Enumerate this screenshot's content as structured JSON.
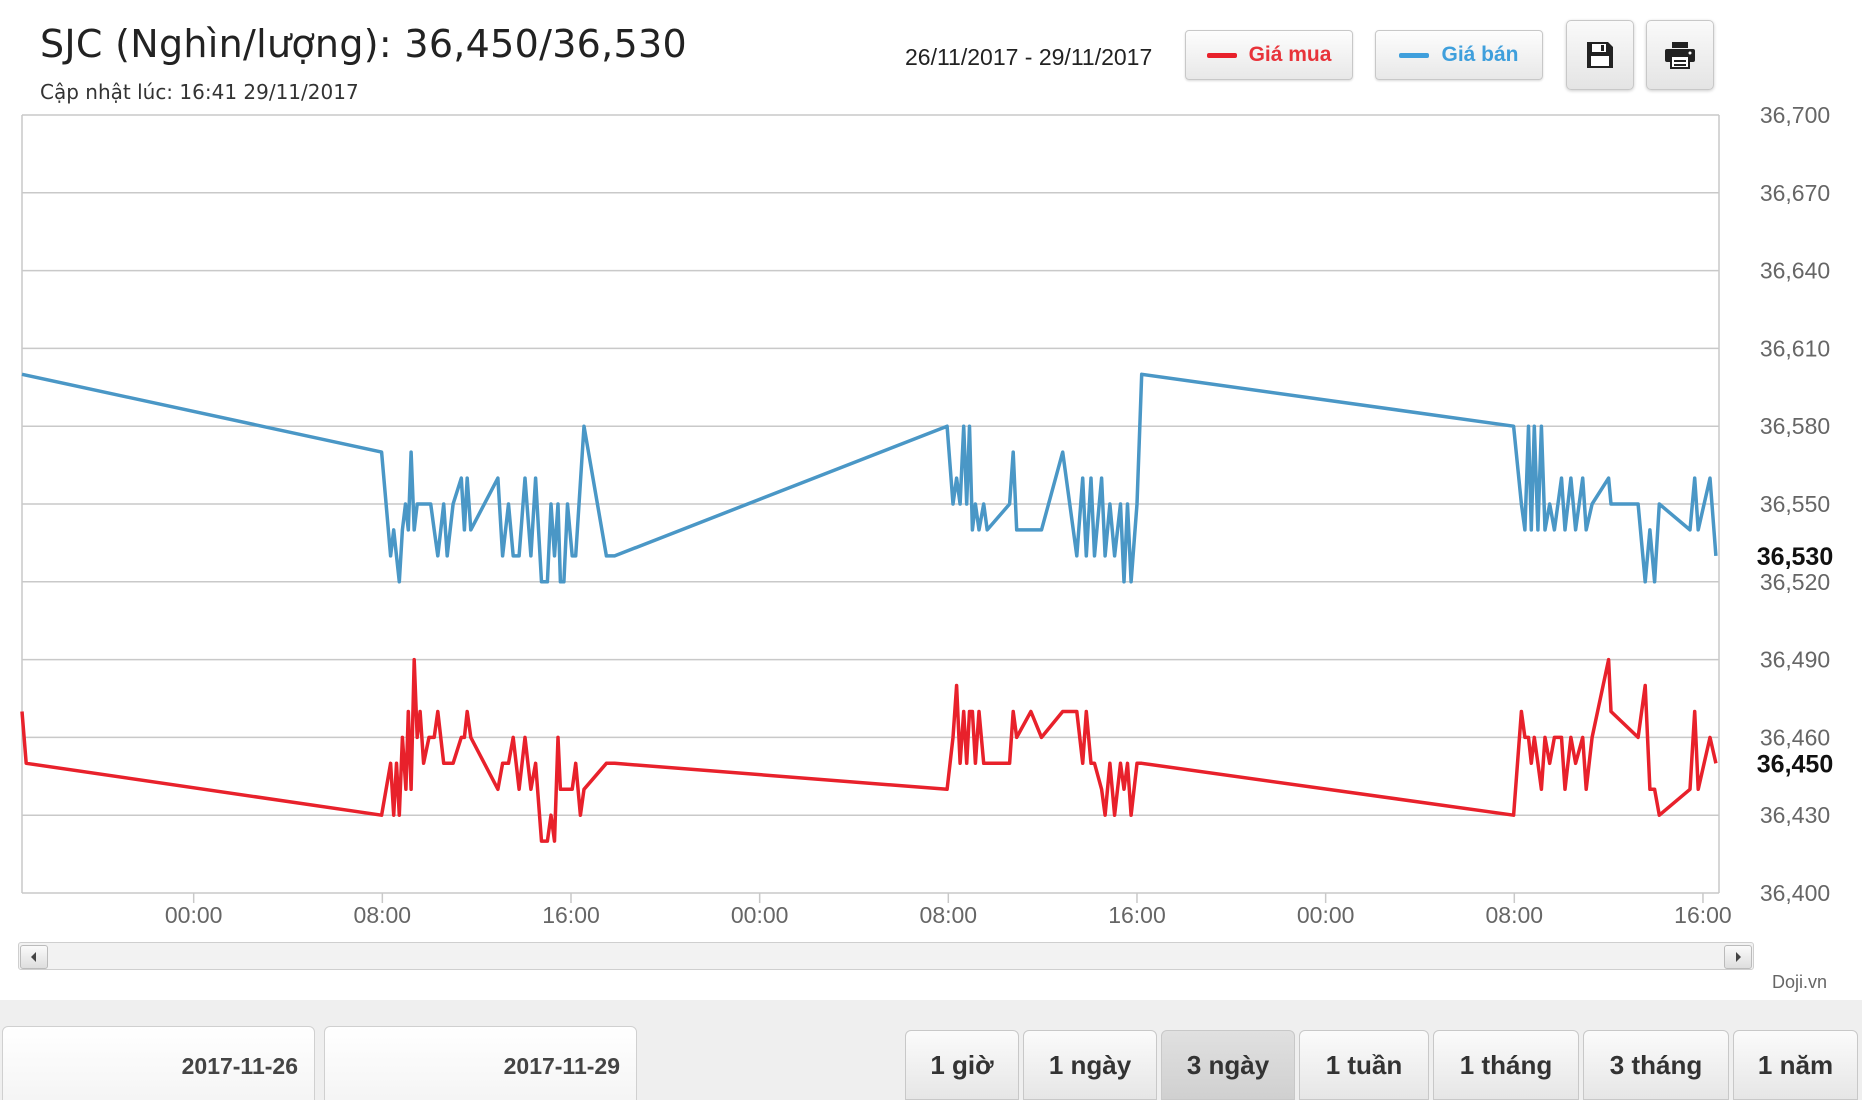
{
  "header": {
    "title": "SJC (Nghìn/lượng): 36,450/36,530",
    "updated": "Cập nhật lúc: 16:41 29/11/2017",
    "date_range": "26/11/2017 - 29/11/2017"
  },
  "legend": {
    "buy_label": "Giá mua",
    "sell_label": "Giá bán",
    "buy_color": "#e8212b",
    "sell_color": "#4a97c6"
  },
  "toolbar": {
    "save_icon": "floppy-disk-icon",
    "print_icon": "printer-icon"
  },
  "credit": "Doji.vn",
  "navigator": {
    "start_date": "2017-11-26",
    "end_date": "2017-11-29"
  },
  "range_buttons": [
    "1 giờ",
    "1 ngày",
    "3 ngày",
    "1 tuần",
    "1 tháng",
    "3 tháng",
    "1 năm"
  ],
  "active_range": "3 ngày",
  "chart_data": {
    "type": "line",
    "x_unit": "hours",
    "x_ticks": [
      {
        "label": "00:00",
        "x": 0
      },
      {
        "label": "08:00",
        "x": 8
      },
      {
        "label": "16:00",
        "x": 16
      },
      {
        "label": "00:00",
        "x": 24
      },
      {
        "label": "08:00",
        "x": 32
      },
      {
        "label": "16:00",
        "x": 40
      },
      {
        "label": "00:00",
        "x": 48
      },
      {
        "label": "08:00",
        "x": 56
      },
      {
        "label": "16:00",
        "x": 64
      }
    ],
    "x_range": [
      -7.28,
      64.68
    ],
    "y_range": [
      36400,
      36700
    ],
    "y_ticks": [
      36400,
      36430,
      36460,
      36490,
      36520,
      36550,
      36580,
      36610,
      36640,
      36670,
      36700
    ],
    "last_values": {
      "buy": "36,450",
      "sell": "36,530"
    },
    "grid": true,
    "series": [
      {
        "name": "Giá bán",
        "key": "sell",
        "color": "#4a97c6",
        "points": [
          [
            -7.28,
            36600
          ],
          [
            7.97,
            36570
          ],
          [
            8.35,
            36530
          ],
          [
            8.48,
            36540
          ],
          [
            8.6,
            36530
          ],
          [
            8.72,
            36520
          ],
          [
            8.85,
            36540
          ],
          [
            8.98,
            36550
          ],
          [
            9.1,
            36540
          ],
          [
            9.22,
            36570
          ],
          [
            9.35,
            36540
          ],
          [
            9.48,
            36550
          ],
          [
            9.8,
            36550
          ],
          [
            10.05,
            36550
          ],
          [
            10.2,
            36540
          ],
          [
            10.35,
            36530
          ],
          [
            10.6,
            36550
          ],
          [
            10.75,
            36530
          ],
          [
            11.0,
            36550
          ],
          [
            11.35,
            36560
          ],
          [
            11.48,
            36540
          ],
          [
            11.6,
            36560
          ],
          [
            11.75,
            36540
          ],
          [
            12.9,
            36560
          ],
          [
            13.1,
            36530
          ],
          [
            13.35,
            36550
          ],
          [
            13.55,
            36530
          ],
          [
            13.8,
            36530
          ],
          [
            14.05,
            36560
          ],
          [
            14.3,
            36530
          ],
          [
            14.5,
            36560
          ],
          [
            14.75,
            36520
          ],
          [
            15.0,
            36520
          ],
          [
            15.15,
            36550
          ],
          [
            15.3,
            36530
          ],
          [
            15.45,
            36550
          ],
          [
            15.55,
            36520
          ],
          [
            15.7,
            36520
          ],
          [
            15.85,
            36550
          ],
          [
            16.05,
            36530
          ],
          [
            16.2,
            36530
          ],
          [
            16.55,
            36580
          ],
          [
            17.5,
            36530
          ],
          [
            17.85,
            36530
          ],
          [
            31.95,
            36580
          ],
          [
            32.2,
            36550
          ],
          [
            32.35,
            36560
          ],
          [
            32.5,
            36550
          ],
          [
            32.65,
            36580
          ],
          [
            32.78,
            36550
          ],
          [
            32.9,
            36580
          ],
          [
            33.02,
            36540
          ],
          [
            33.15,
            36550
          ],
          [
            33.3,
            36540
          ],
          [
            33.5,
            36550
          ],
          [
            33.65,
            36540
          ],
          [
            34.6,
            36550
          ],
          [
            34.75,
            36570
          ],
          [
            34.9,
            36540
          ],
          [
            35.5,
            36540
          ],
          [
            35.95,
            36540
          ],
          [
            36.85,
            36570
          ],
          [
            37.45,
            36530
          ],
          [
            37.7,
            36560
          ],
          [
            37.85,
            36530
          ],
          [
            38.05,
            36560
          ],
          [
            38.2,
            36530
          ],
          [
            38.5,
            36560
          ],
          [
            38.65,
            36530
          ],
          [
            38.85,
            36550
          ],
          [
            39.05,
            36530
          ],
          [
            39.3,
            36550
          ],
          [
            39.45,
            36520
          ],
          [
            39.6,
            36550
          ],
          [
            39.75,
            36520
          ],
          [
            40.0,
            36550
          ],
          [
            40.2,
            36600
          ],
          [
            55.97,
            36580
          ],
          [
            56.3,
            36550
          ],
          [
            56.45,
            36540
          ],
          [
            56.6,
            36580
          ],
          [
            56.72,
            36540
          ],
          [
            56.85,
            36580
          ],
          [
            57.0,
            36540
          ],
          [
            57.15,
            36580
          ],
          [
            57.3,
            36540
          ],
          [
            57.5,
            36550
          ],
          [
            57.7,
            36540
          ],
          [
            58.0,
            36560
          ],
          [
            58.15,
            36540
          ],
          [
            58.4,
            36560
          ],
          [
            58.6,
            36540
          ],
          [
            58.9,
            36560
          ],
          [
            59.05,
            36540
          ],
          [
            59.3,
            36550
          ],
          [
            60.0,
            36560
          ],
          [
            60.1,
            36550
          ],
          [
            61.25,
            36550
          ],
          [
            61.55,
            36520
          ],
          [
            61.75,
            36540
          ],
          [
            61.95,
            36520
          ],
          [
            62.15,
            36550
          ],
          [
            63.45,
            36540
          ],
          [
            63.65,
            36560
          ],
          [
            63.8,
            36540
          ],
          [
            64.3,
            36560
          ],
          [
            64.55,
            36530
          ]
        ]
      },
      {
        "name": "Giá mua",
        "key": "buy",
        "color": "#e8212b",
        "points": [
          [
            -7.28,
            36470
          ],
          [
            -7.1,
            36450
          ],
          [
            7.97,
            36430
          ],
          [
            8.35,
            36450
          ],
          [
            8.48,
            36430
          ],
          [
            8.6,
            36450
          ],
          [
            8.72,
            36430
          ],
          [
            8.85,
            36460
          ],
          [
            9.0,
            36440
          ],
          [
            9.1,
            36470
          ],
          [
            9.22,
            36440
          ],
          [
            9.35,
            36490
          ],
          [
            9.48,
            36460
          ],
          [
            9.6,
            36470
          ],
          [
            9.75,
            36450
          ],
          [
            9.98,
            36460
          ],
          [
            10.2,
            36460
          ],
          [
            10.35,
            36470
          ],
          [
            10.6,
            36450
          ],
          [
            11.0,
            36450
          ],
          [
            11.35,
            36460
          ],
          [
            11.48,
            36460
          ],
          [
            11.6,
            36470
          ],
          [
            11.75,
            36460
          ],
          [
            12.9,
            36440
          ],
          [
            13.1,
            36450
          ],
          [
            13.35,
            36450
          ],
          [
            13.55,
            36460
          ],
          [
            13.8,
            36440
          ],
          [
            14.05,
            36460
          ],
          [
            14.3,
            36440
          ],
          [
            14.5,
            36450
          ],
          [
            14.75,
            36420
          ],
          [
            15.0,
            36420
          ],
          [
            15.15,
            36430
          ],
          [
            15.3,
            36420
          ],
          [
            15.45,
            36460
          ],
          [
            15.55,
            36440
          ],
          [
            15.7,
            36440
          ],
          [
            15.85,
            36440
          ],
          [
            16.05,
            36440
          ],
          [
            16.2,
            36450
          ],
          [
            16.4,
            36430
          ],
          [
            16.55,
            36440
          ],
          [
            17.5,
            36450
          ],
          [
            17.85,
            36450
          ],
          [
            31.95,
            36440
          ],
          [
            32.2,
            36460
          ],
          [
            32.35,
            36480
          ],
          [
            32.5,
            36450
          ],
          [
            32.65,
            36470
          ],
          [
            32.78,
            36450
          ],
          [
            32.9,
            36470
          ],
          [
            33.02,
            36470
          ],
          [
            33.15,
            36450
          ],
          [
            33.3,
            36470
          ],
          [
            33.5,
            36450
          ],
          [
            33.65,
            36450
          ],
          [
            34.6,
            36450
          ],
          [
            34.75,
            36470
          ],
          [
            34.9,
            36460
          ],
          [
            35.5,
            36470
          ],
          [
            35.95,
            36460
          ],
          [
            36.85,
            36470
          ],
          [
            37.45,
            36470
          ],
          [
            37.7,
            36450
          ],
          [
            37.85,
            36470
          ],
          [
            38.05,
            36450
          ],
          [
            38.2,
            36450
          ],
          [
            38.5,
            36440
          ],
          [
            38.65,
            36430
          ],
          [
            38.85,
            36450
          ],
          [
            39.05,
            36430
          ],
          [
            39.3,
            36450
          ],
          [
            39.45,
            36440
          ],
          [
            39.6,
            36450
          ],
          [
            39.75,
            36430
          ],
          [
            40.0,
            36450
          ],
          [
            40.2,
            36450
          ],
          [
            55.97,
            36430
          ],
          [
            56.3,
            36470
          ],
          [
            56.45,
            36460
          ],
          [
            56.6,
            36460
          ],
          [
            56.72,
            36450
          ],
          [
            56.85,
            36460
          ],
          [
            57.0,
            36450
          ],
          [
            57.15,
            36440
          ],
          [
            57.3,
            36460
          ],
          [
            57.5,
            36450
          ],
          [
            57.7,
            36460
          ],
          [
            58.0,
            36460
          ],
          [
            58.15,
            36440
          ],
          [
            58.4,
            36460
          ],
          [
            58.6,
            36450
          ],
          [
            58.9,
            36460
          ],
          [
            59.05,
            36440
          ],
          [
            59.3,
            36460
          ],
          [
            60.0,
            36490
          ],
          [
            60.1,
            36470
          ],
          [
            61.25,
            36460
          ],
          [
            61.55,
            36480
          ],
          [
            61.75,
            36440
          ],
          [
            61.95,
            36440
          ],
          [
            62.15,
            36430
          ],
          [
            63.45,
            36440
          ],
          [
            63.65,
            36470
          ],
          [
            63.8,
            36440
          ],
          [
            64.3,
            36460
          ],
          [
            64.55,
            36450
          ]
        ]
      }
    ]
  }
}
